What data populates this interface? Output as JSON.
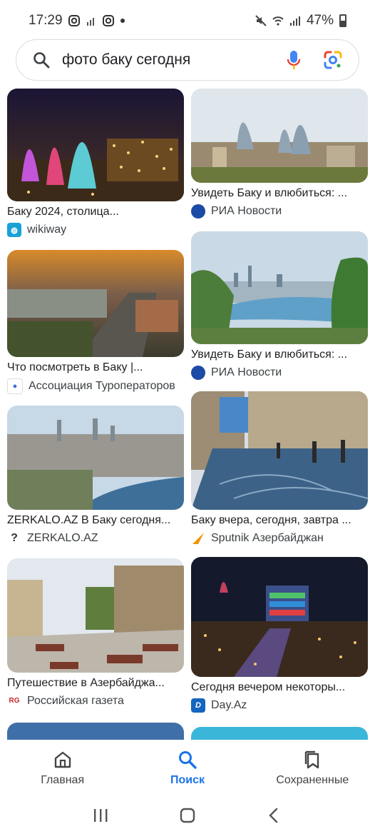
{
  "status_bar": {
    "time": "17:29",
    "battery": "47%"
  },
  "search": {
    "query": "фото баку сегодня"
  },
  "results": [
    {
      "caption": "Баку 2024, столица...",
      "source": "wikiway",
      "favicon_color": "#1aa1d6",
      "favicon": "globe-icon"
    },
    {
      "caption": "Увидеть Баку и влюбиться: ...",
      "source": "РИА Новости",
      "favicon_color": "#1c4aa6",
      "favicon": "ria-icon"
    },
    {
      "caption": "Что посмотреть в Баку |...",
      "source": "Ассоциация Туроператоров",
      "favicon_color": "#3a6fd8",
      "favicon": "ator-icon"
    },
    {
      "caption": "Увидеть Баку и влюбиться: ...",
      "source": "РИА Новости",
      "favicon_color": "#1c4aa6",
      "favicon": "ria-icon"
    },
    {
      "caption": "ZERKALO.AZ В Баку сегодня...",
      "source": "ZERKALO.AZ",
      "favicon_color": "#333333",
      "favicon": "zerkalo-icon"
    },
    {
      "caption": "Баку вчера, сегодня, завтра ...",
      "source": "Sputnik Азербайджан",
      "favicon_color": "#f39200",
      "favicon": "sputnik-icon"
    },
    {
      "caption": "Путешествие в Азербайджа...",
      "source": "Российская газета",
      "favicon_color": "#c62828",
      "favicon": "rg-icon"
    },
    {
      "caption": "Сегодня вечером некоторы...",
      "source": "Day.Az",
      "favicon_color": "#1565c0",
      "favicon": "dayaz-icon"
    }
  ],
  "bottom_nav": {
    "home": "Главная",
    "search": "Поиск",
    "saved": "Сохраненные"
  }
}
